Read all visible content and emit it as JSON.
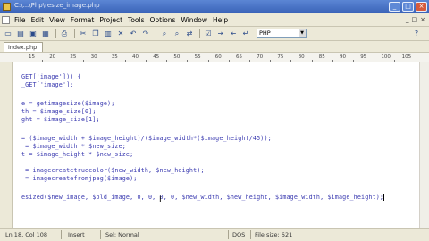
{
  "window": {
    "title": "C:\\...\\Php\\resize_image.php",
    "controls": [
      "_",
      "□",
      "×"
    ]
  },
  "menubar": {
    "items": [
      "File",
      "Edit",
      "View",
      "Format",
      "Project",
      "Tools",
      "Options",
      "Window",
      "Help"
    ],
    "mdi_controls": [
      "_",
      "□",
      "×"
    ]
  },
  "toolbar": {
    "icons": [
      "new-file-icon",
      "open-folder-icon",
      "save-icon",
      "save-all-icon",
      "print-icon",
      "cut-icon",
      "copy-icon",
      "paste-icon",
      "delete-icon",
      "undo-icon",
      "redo-icon",
      "find-icon",
      "find-next-icon",
      "replace-icon",
      "bookmark-icon",
      "indent-icon",
      "outdent-icon",
      "word-wrap-icon"
    ],
    "language_select": "PHP"
  },
  "tabs": [
    {
      "label": "index.php"
    }
  ],
  "ruler": {
    "labels": [
      "15",
      "20",
      "25",
      "30",
      "35",
      "40",
      "45",
      "50",
      "55",
      "60",
      "65",
      "70",
      "75",
      "80",
      "85",
      "90",
      "95",
      "100",
      "105"
    ]
  },
  "editor": {
    "lines": [
      "GET['image'])) {",
      "_GET['image'];",
      "",
      "e = getimagesize($image);",
      "th = $image_size[0];",
      "ght = $image_size[1];",
      "",
      "= ($image_width + $image_height)/($image_width*($image_height/45));",
      " = $image_width * $new_size;",
      "t = $image_height * $new_size;",
      "",
      " = imagecreatetruecolor($new_width, $new_height);",
      " = imagecreatefromjpeg($image);",
      "",
      "esized($new_image, $old_image, 0, 0, 0, 0, $new_width, $new_height, $image_width, $image_height);"
    ]
  },
  "statusbar": {
    "position": "Ln 18, Col 108",
    "mode": "Insert",
    "selection": "Sel: Normal",
    "format": "DOS",
    "file_size": "File size: 621"
  }
}
